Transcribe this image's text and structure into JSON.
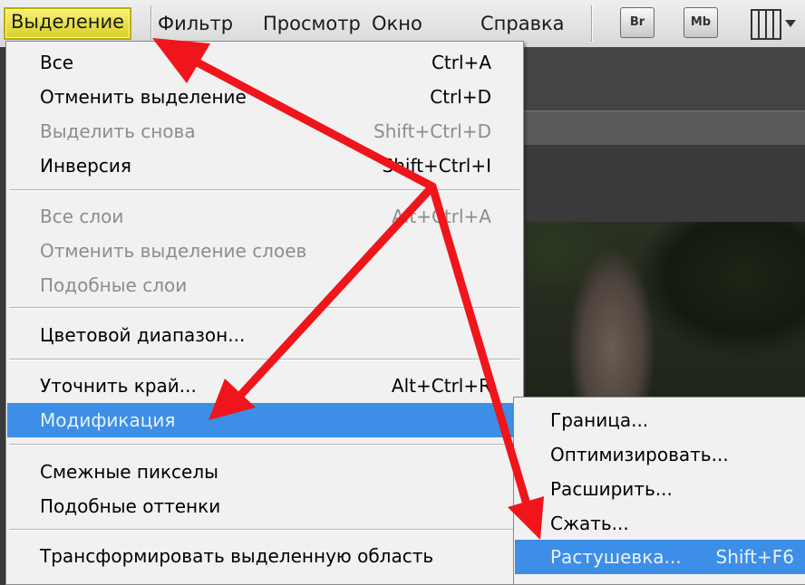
{
  "menubar": {
    "items": [
      {
        "label": "Выделение",
        "active": true
      },
      {
        "label": "Фильтр"
      },
      {
        "label": "Просмотр"
      },
      {
        "label": "Окно"
      },
      {
        "label": "Справка"
      }
    ],
    "toolbar": {
      "bridge_label": "Br",
      "minibridge_label": "Mb",
      "arrange_icon": "grid-layout-icon"
    }
  },
  "select_menu": {
    "items": [
      {
        "label": "Все",
        "shortcut": "Ctrl+A",
        "enabled": true
      },
      {
        "label": "Отменить выделение",
        "shortcut": "Ctrl+D",
        "enabled": true
      },
      {
        "label": "Выделить снова",
        "shortcut": "Shift+Ctrl+D",
        "enabled": false
      },
      {
        "label": "Инверсия",
        "shortcut": "Shift+Ctrl+I",
        "enabled": true
      },
      {
        "label": "Все слои",
        "shortcut": "Alt+Ctrl+A",
        "enabled": false
      },
      {
        "label": "Отменить выделение слоев",
        "shortcut": "",
        "enabled": false
      },
      {
        "label": "Подобные слои",
        "shortcut": "",
        "enabled": false
      },
      {
        "label": "Цветовой диапазон...",
        "shortcut": "",
        "enabled": true
      },
      {
        "label": "Уточнить край...",
        "shortcut": "Alt+Ctrl+R",
        "enabled": true
      },
      {
        "label": "Модификация",
        "shortcut": "",
        "enabled": true,
        "highlighted": true,
        "has_submenu": true
      },
      {
        "label": "Смежные пикселы",
        "shortcut": "",
        "enabled": true
      },
      {
        "label": "Подобные оттенки",
        "shortcut": "",
        "enabled": true
      },
      {
        "label": "Трансформировать выделенную область",
        "shortcut": "",
        "enabled": true
      }
    ]
  },
  "modify_submenu": {
    "items": [
      {
        "label": "Граница...",
        "shortcut": ""
      },
      {
        "label": "Оптимизировать...",
        "shortcut": ""
      },
      {
        "label": "Расширить...",
        "shortcut": ""
      },
      {
        "label": "Сжать...",
        "shortcut": ""
      },
      {
        "label": "Растушевка...",
        "shortcut": "Shift+F6",
        "highlighted": true
      }
    ]
  },
  "colors": {
    "highlight": "#3d8ee6",
    "active_menu": "#e6dd3c",
    "annotation_arrow": "#f0141b"
  }
}
